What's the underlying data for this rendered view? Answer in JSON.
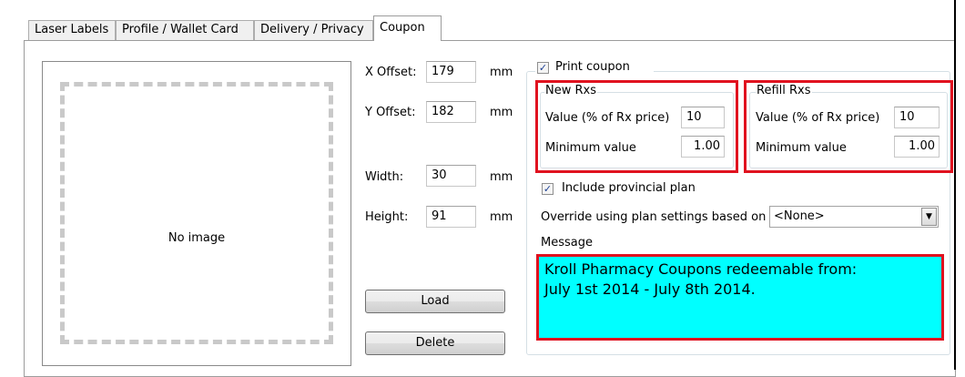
{
  "tabs": [
    {
      "label": "Laser Labels"
    },
    {
      "label": "Profile / Wallet Card"
    },
    {
      "label": "Delivery / Privacy"
    },
    {
      "label": "Coupon"
    }
  ],
  "image_panel": {
    "empty_text": "No image"
  },
  "position": {
    "x_offset_label": "X Offset:",
    "x_offset_value": "179",
    "y_offset_label": "Y Offset:",
    "y_offset_value": "182",
    "width_label": "Width:",
    "width_value": "30",
    "height_label": "Height:",
    "height_value": "91",
    "unit": "mm"
  },
  "buttons": {
    "load": "Load",
    "delete": "Delete"
  },
  "print_coupon": {
    "label": "Print coupon",
    "checked": true
  },
  "new_rxs": {
    "title": "New Rxs",
    "value_label": "Value (% of Rx price)",
    "value": "10",
    "min_label": "Minimum value",
    "min_value": "1.00"
  },
  "refill_rxs": {
    "title": "Refill Rxs",
    "value_label": "Value (% of Rx price)",
    "value": "10",
    "min_label": "Minimum value",
    "min_value": "1.00"
  },
  "include_provincial": {
    "label": "Include provincial plan",
    "checked": true
  },
  "override": {
    "label": "Override using plan settings based on",
    "selected": "<None>"
  },
  "message": {
    "label": "Message",
    "line1": "Kroll Pharmacy Coupons redeemable from:",
    "line2": "July 1st 2014 - July 8th 2014."
  },
  "colors": {
    "highlight_border": "#e0121f",
    "message_bg": "#00ffff"
  }
}
